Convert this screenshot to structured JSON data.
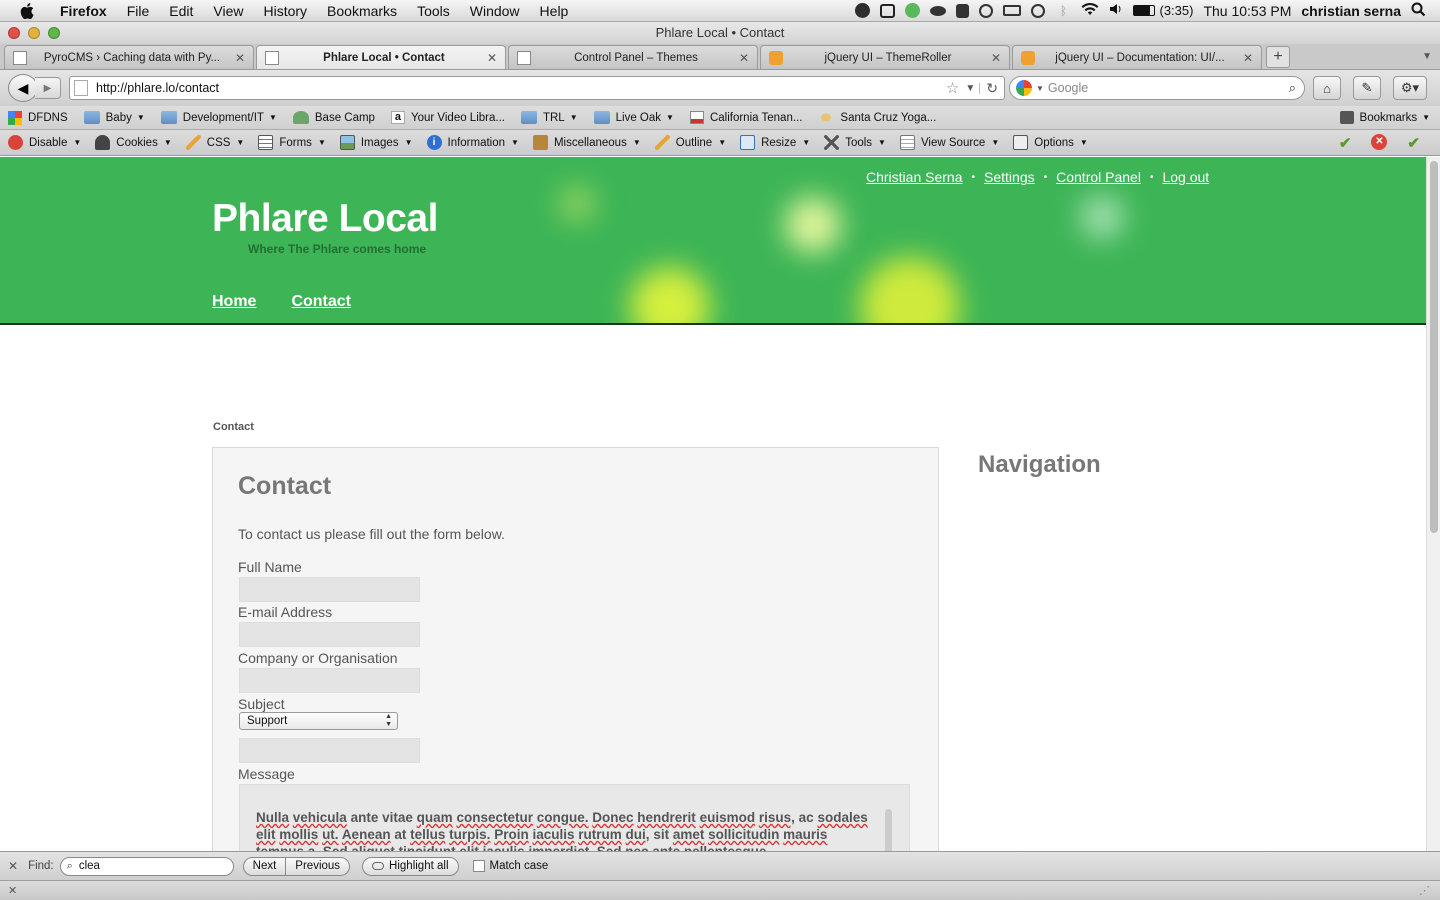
{
  "menubar": {
    "app": "Firefox",
    "items": [
      "File",
      "Edit",
      "View",
      "History",
      "Bookmarks",
      "Tools",
      "Window",
      "Help"
    ],
    "battery": "(3:35)",
    "clock": "Thu 10:53 PM",
    "user": "christian serna"
  },
  "window": {
    "title": "Phlare Local • Contact"
  },
  "tabs": [
    {
      "label": "PyroCMS › Caching data with Py...",
      "active": false
    },
    {
      "label": "Phlare Local • Contact",
      "active": true
    },
    {
      "label": "Control Panel – Themes",
      "active": false
    },
    {
      "label": "jQuery UI – ThemeRoller",
      "active": false
    },
    {
      "label": "jQuery UI – Documentation: UI/...",
      "active": false
    }
  ],
  "navbar": {
    "url": "http://phlare.lo/contact",
    "search_placeholder": "Google"
  },
  "bookmarks": {
    "items": [
      {
        "label": "DFDNS",
        "dropdown": false
      },
      {
        "label": "Baby",
        "dropdown": true
      },
      {
        "label": "Development/IT",
        "dropdown": true
      },
      {
        "label": "Base Camp",
        "dropdown": false
      },
      {
        "label": "Your Video Libra...",
        "dropdown": false
      },
      {
        "label": "TRL",
        "dropdown": true
      },
      {
        "label": "Live Oak",
        "dropdown": true
      },
      {
        "label": "California Tenan...",
        "dropdown": false
      },
      {
        "label": "Santa Cruz Yoga...",
        "dropdown": false
      }
    ],
    "menu_label": "Bookmarks"
  },
  "devtoolbar": {
    "items": [
      "Disable",
      "Cookies",
      "CSS",
      "Forms",
      "Images",
      "Information",
      "Miscellaneous",
      "Outline",
      "Resize",
      "Tools",
      "View Source",
      "Options"
    ]
  },
  "site": {
    "name": "Phlare Local",
    "slogan": "Where The Phlare comes home",
    "nav": [
      "Home",
      "Contact"
    ],
    "user_links": [
      "Christian Serna",
      "Settings",
      "Control Panel",
      "Log out"
    ],
    "user_sep": "•"
  },
  "page": {
    "breadcrumb": "Contact",
    "heading": "Contact",
    "intro": "To contact us please fill out the form below.",
    "fields": {
      "full_name_label": "Full Name",
      "email_label": "E-mail Address",
      "company_label": "Company or Organisation",
      "subject_label": "Subject",
      "subject_value": "Support",
      "message_label": "Message"
    },
    "message_text": "Nulla vehicula ante vitae quam consectetur congue. Donec hendrerit euismod risus, ac sodales elit mollis ut. Aenean at tellus turpis. Proin iaculis rutrum dui, sit amet sollicitudin mauris tempus a. Sed aliquet tincidunt elit iaculis imperdiet. Sed nec ante pellentesque"
  },
  "sidebar": {
    "heading": "Navigation"
  },
  "findbar": {
    "label": "Find:",
    "query": "clea",
    "next": "Next",
    "previous": "Previous",
    "highlight": "Highlight all",
    "match_case": "Match case"
  },
  "colors": {
    "header_green": "#3db556",
    "header_stripe": "#1a3524"
  }
}
